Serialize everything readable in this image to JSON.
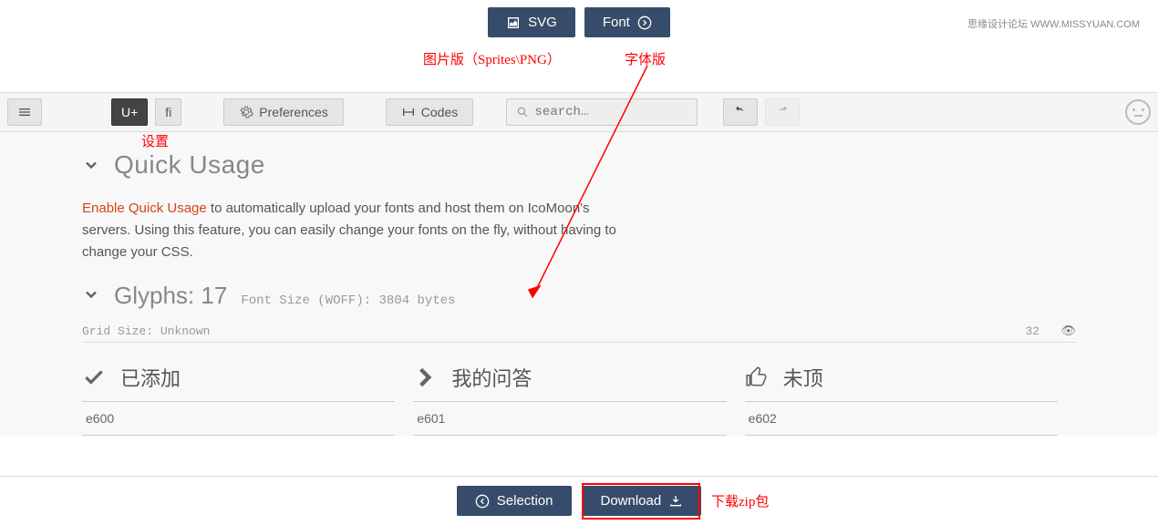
{
  "watermark": "思缘设计论坛  WWW.MISSYUAN.COM",
  "topButtons": {
    "svg": "SVG",
    "font": "Font"
  },
  "annotations": {
    "svgNote": "图片版（Sprites\\PNG）",
    "fontNote": "字体版",
    "prefNote": "设置",
    "downloadNote": "下载zip包"
  },
  "toolbar": {
    "uplus": "U+",
    "fi": "fi",
    "preferences": "Preferences",
    "codes": "Codes",
    "searchPlaceholder": "search…"
  },
  "sections": {
    "quickUsage": "Quick Usage",
    "quickUsageLink": "Enable Quick Usage",
    "quickUsageDesc": " to automatically upload your fonts and host them on IcoMoon's servers. Using this feature, you can easily change your fonts on the fly, without having to change your CSS.",
    "glyphsLabel": "Glyphs: ",
    "glyphsCount": "17",
    "fontSize": "Font Size (WOFF): 3804 bytes",
    "gridSize": "Grid Size: Unknown",
    "gridCount": "32"
  },
  "glyphs": [
    {
      "name": "已添加",
      "code": "e600"
    },
    {
      "name": "我的问答",
      "code": "e601"
    },
    {
      "name": "未顶",
      "code": "e602"
    }
  ],
  "bottom": {
    "selection": "Selection",
    "download": "Download"
  }
}
